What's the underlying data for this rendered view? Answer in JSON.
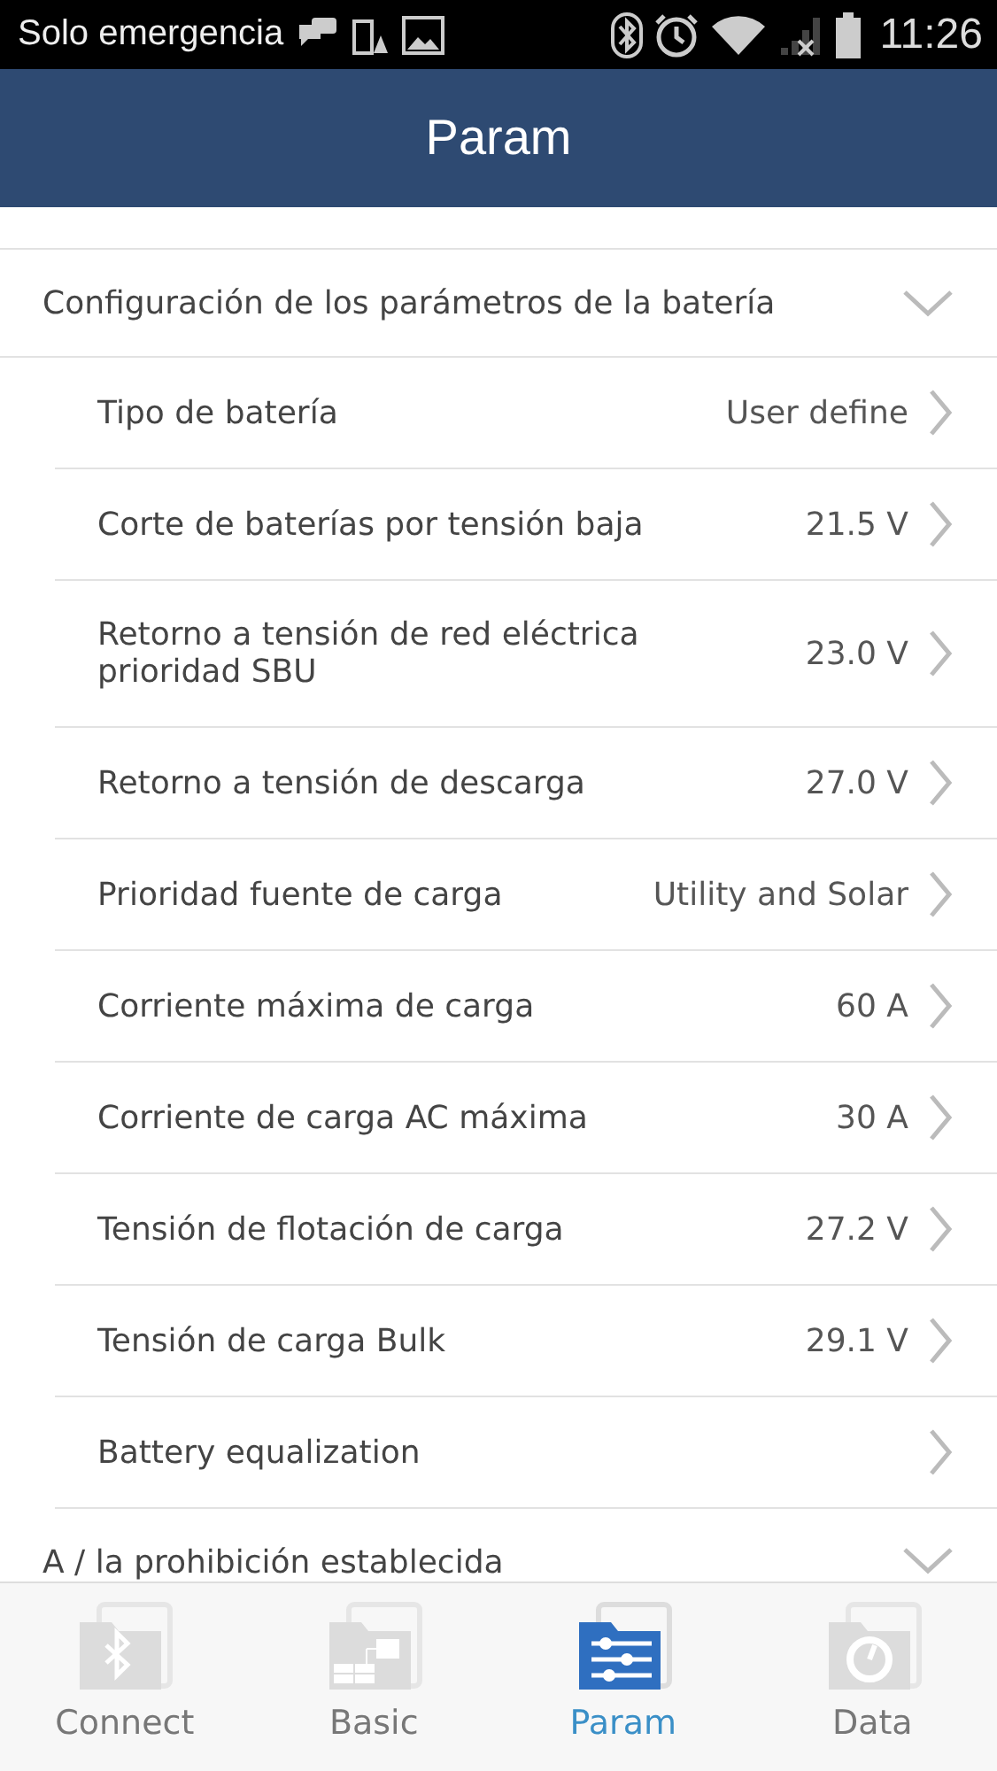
{
  "status_bar": {
    "carrier": "Solo emergencia",
    "time": "11:26"
  },
  "header": {
    "title": "Param"
  },
  "sections": [
    {
      "title": "Configuración de los parámetros de la batería",
      "items": [
        {
          "label": "Tipo de batería",
          "value": "User define"
        },
        {
          "label": "Corte de baterías por tensión baja",
          "value": "21.5 V"
        },
        {
          "label": "Retorno a tensión de red eléctrica prioridad SBU",
          "value": "23.0 V"
        },
        {
          "label": "Retorno a tensión de descarga",
          "value": "27.0 V"
        },
        {
          "label": "Prioridad fuente de carga",
          "value": "Utility and Solar"
        },
        {
          "label": "Corriente máxima de carga",
          "value": "60 A"
        },
        {
          "label": "Corriente de carga AC máxima",
          "value": "30 A"
        },
        {
          "label": "Tensión de flotación de carga",
          "value": "27.2 V"
        },
        {
          "label": "Tensión de carga Bulk",
          "value": "29.1 V"
        },
        {
          "label": "Battery equalization"
        }
      ]
    },
    {
      "title": "A / la prohibición establecida"
    }
  ],
  "tabs": [
    {
      "label": "Connect",
      "selected": false
    },
    {
      "label": "Basic",
      "selected": false
    },
    {
      "label": "Param",
      "selected": true
    },
    {
      "label": "Data",
      "selected": false
    }
  ]
}
